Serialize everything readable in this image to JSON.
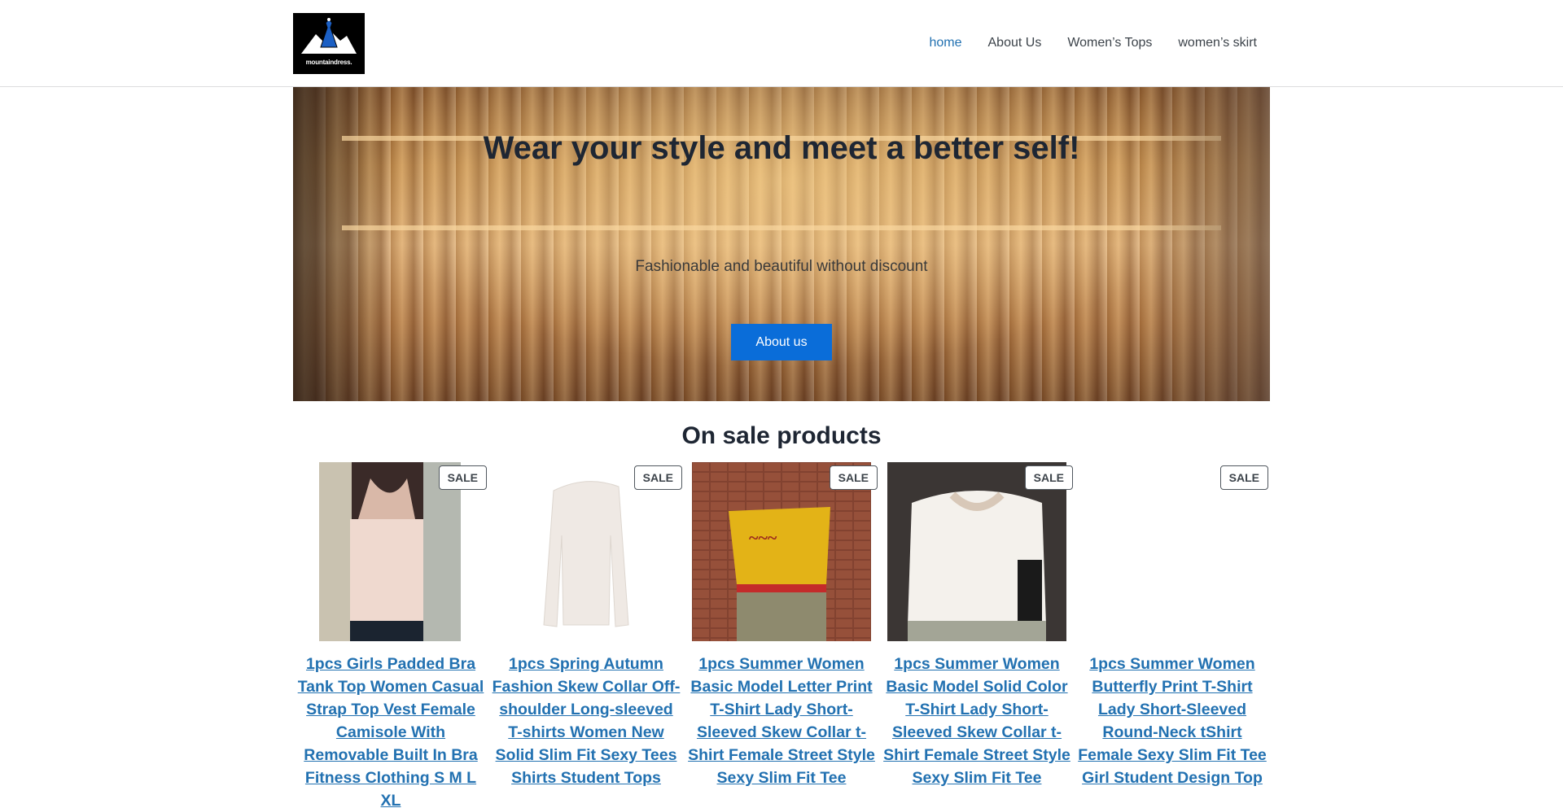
{
  "header": {
    "logo_text": "mountaindress.",
    "nav": [
      {
        "label": "home",
        "active": true
      },
      {
        "label": "About Us",
        "active": false
      },
      {
        "label": "Women’s Tops",
        "active": false
      },
      {
        "label": "women’s skirt",
        "active": false
      }
    ]
  },
  "hero": {
    "title": "Wear your style and meet a better self!",
    "subtitle": "Fashionable and beautiful without discount",
    "button_label": "About us"
  },
  "sale_section": {
    "title": "On sale products",
    "badge_label": "SALE",
    "products": [
      {
        "title": "1pcs Girls Padded Bra Tank Top Women Casual Strap Top Vest Female Camisole With Removable Built In Bra Fitness Clothing S M L XL"
      },
      {
        "title": "1pcs Spring Autumn Fashion Skew Collar Off-shoulder Long-sleeved T-shirts Women New Solid Slim Fit Sexy Tees Shirts Student Tops"
      },
      {
        "title": "1pcs Summer Women Basic Model Letter Print T-Shirt Lady Short-Sleeved Skew Collar t-Shirt Female Street Style Sexy Slim Fit Tee"
      },
      {
        "title": "1pcs Summer Women Basic Model Solid Color T-Shirt Lady Short-Sleeved Skew Collar t-Shirt Female Street Style Sexy Slim Fit Tee"
      },
      {
        "title": "1pcs Summer Women Butterfly Print T-Shirt Lady Short-Sleeved Round-Neck tShirt Female Sexy Slim Fit Tee Girl Student Design Top"
      }
    ]
  },
  "colors": {
    "link": "#2271b1",
    "button": "#0a6dd9",
    "text": "#1e2633"
  }
}
